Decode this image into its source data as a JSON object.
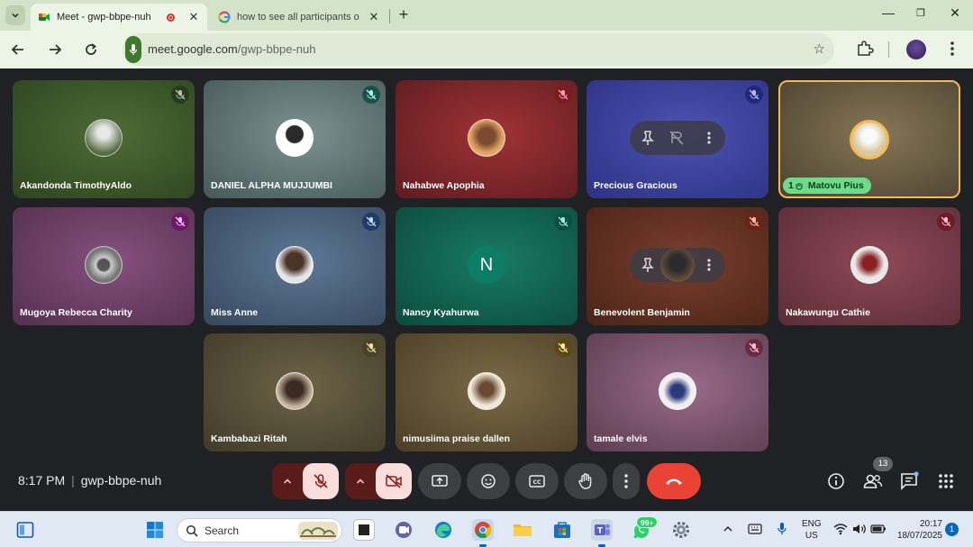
{
  "browser": {
    "tabs": [
      {
        "title": "Meet - gwp-bbpe-nuh",
        "active": true
      },
      {
        "title": "how to see all participants o",
        "active": false
      }
    ],
    "url_host": "meet.google.com",
    "url_path": "/gwp-bbpe-nuh"
  },
  "meet": {
    "participants": [
      {
        "name": "Akandonda TimothyAldo"
      },
      {
        "name": "DANIEL ALPHA MUJJUMBI"
      },
      {
        "name": "Nahabwe Apophia"
      },
      {
        "name": "Precious Gracious"
      },
      {
        "name": "Matovu Pius",
        "badge_count": "1"
      },
      {
        "name": "Mugoya Rebecca Charity"
      },
      {
        "name": "Miss Anne"
      },
      {
        "name": "Nancy Kyahurwa",
        "initial": "N"
      },
      {
        "name": "Benevolent Benjamin"
      },
      {
        "name": "Nakawungu Cathie"
      },
      {
        "name": "Kambabazi Ritah"
      },
      {
        "name": "nimusiima praise dallen"
      },
      {
        "name": "tamale elvis"
      }
    ],
    "time": "8:17 PM",
    "meeting_code": "gwp-bbpe-nuh",
    "participant_count": "13",
    "colors": {
      "end_call": "#ea4335",
      "speaking": "#f8b84e",
      "accent": "#6ddc8a"
    }
  },
  "taskbar": {
    "search_label": "Search",
    "whatsapp_badge": "99+",
    "lang_line1": "ENG",
    "lang_line2": "US",
    "clock_time": "20:17",
    "clock_date": "18/07/2025",
    "notification_count": "1"
  }
}
